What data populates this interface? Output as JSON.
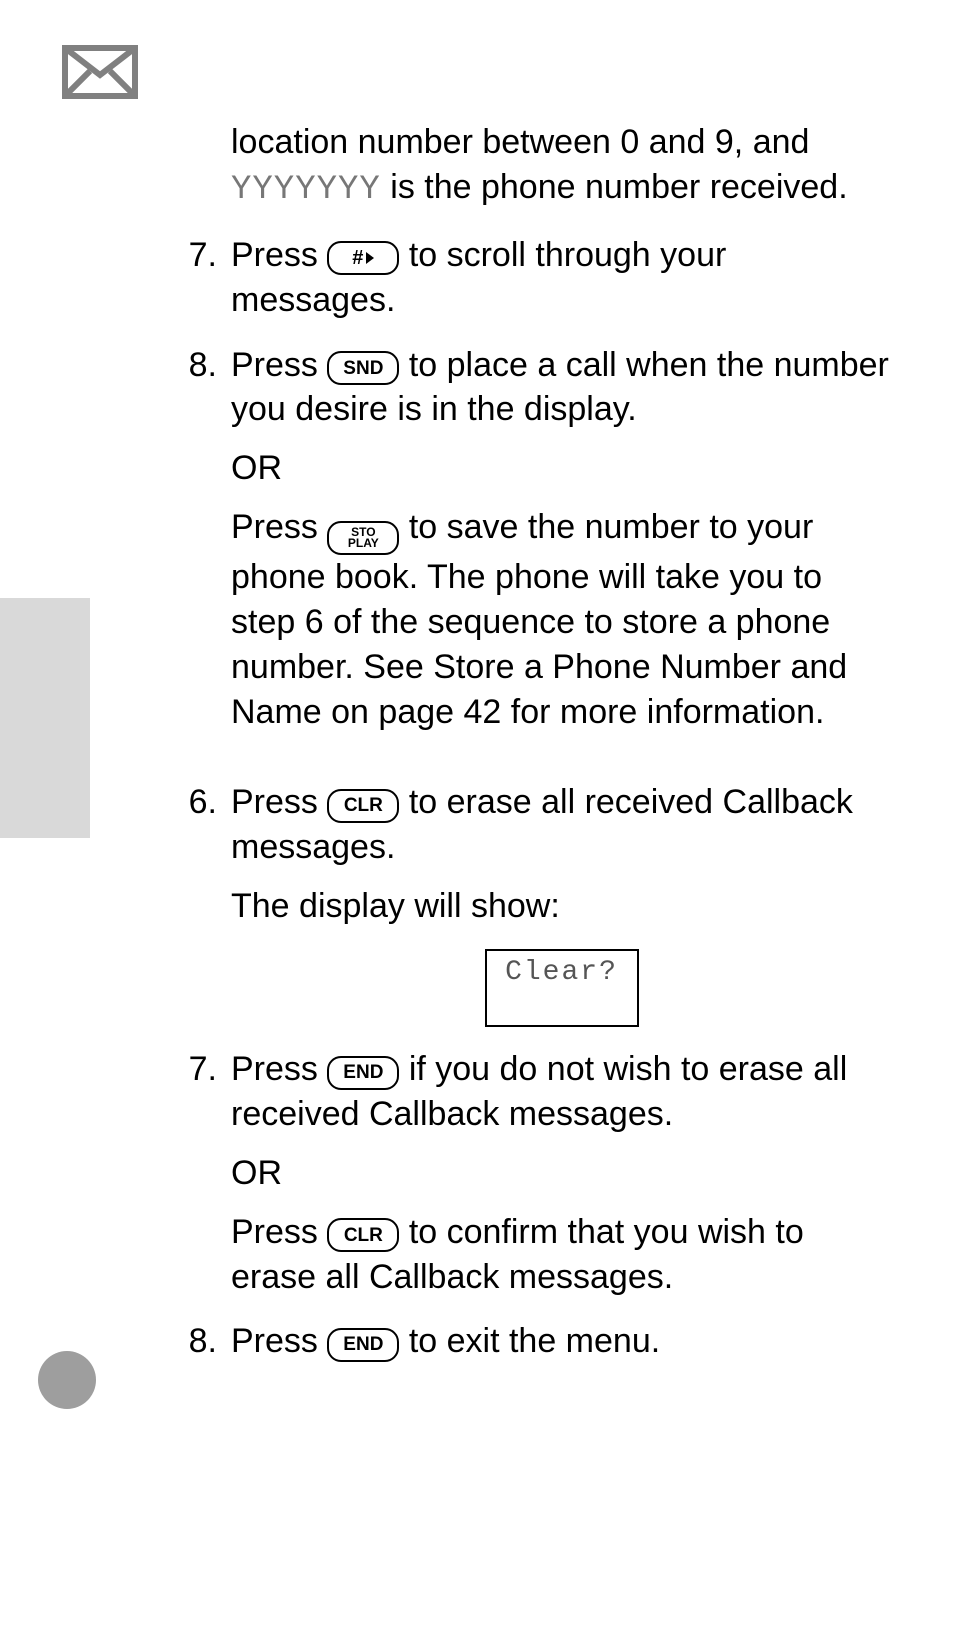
{
  "keys": {
    "hash": "#",
    "snd": "SND",
    "sto": "STO",
    "play": "PLAY",
    "clr": "CLR",
    "end": "END"
  },
  "steps": {
    "intro_a": "location number between 0 and 9, and ",
    "intro_placeholder": "YYYYYYY",
    "intro_b": " is the phone number received.",
    "s7a_num": "7.",
    "s7a_pre": "Press ",
    "s7a_post": " to scroll through your messages.",
    "s8a_num": "8.",
    "s8a_pre": "Press ",
    "s8a_post": " to place a call when the number you desire is in the display.",
    "or": "OR",
    "s8a_alt_pre": "Press ",
    "s8a_alt_post": " to save the number to your phone book. The phone will take you to step 6 of the sequence to store a phone number. See Store a Phone Number and Name on page 42 for more information.",
    "s6_num": "6.",
    "s6_pre": "Press ",
    "s6_post": " to erase all received Callback messages.",
    "s6_show": "The display will show:",
    "screen_text": "Clear?",
    "s7b_num": "7.",
    "s7b_pre": "Press ",
    "s7b_post": " if you do not wish to erase all received Callback messages.",
    "s7b_alt_pre": "Press ",
    "s7b_alt_post": " to confirm that you wish to erase all Callback messages.",
    "s8b_num": "8.",
    "s8b_pre": "Press ",
    "s8b_post": " to exit the menu."
  }
}
